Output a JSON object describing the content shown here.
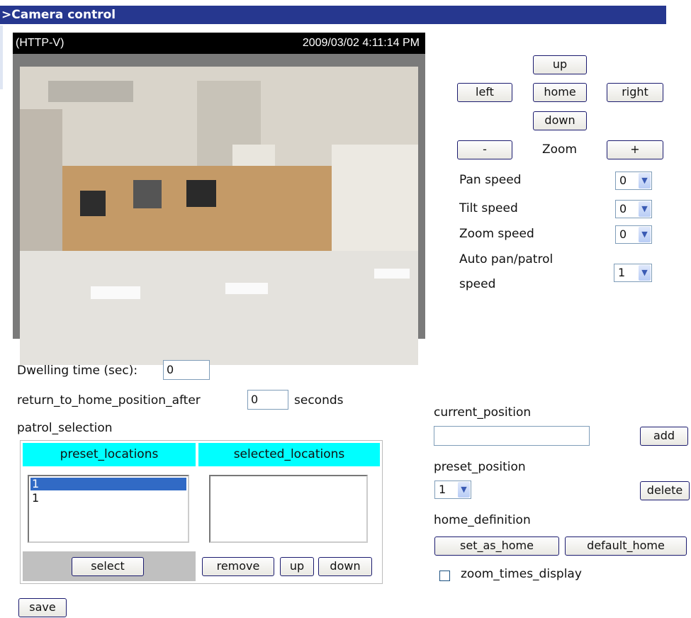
{
  "title": ">Camera control",
  "video": {
    "mode": "(HTTP-V)",
    "timestamp": "2009/03/02 4:11:14 PM"
  },
  "ptz": {
    "up": "up",
    "left": "left",
    "home": "home",
    "right": "right",
    "down": "down",
    "zoom_out": "-",
    "zoom_label": "Zoom",
    "zoom_in": "+"
  },
  "speeds": {
    "pan_label": "Pan speed",
    "pan_value": "0",
    "tilt_label": "Tilt speed",
    "tilt_value": "0",
    "zoom_label": "Zoom speed",
    "zoom_value": "0",
    "auto_label_1": "Auto pan/patrol",
    "auto_label_2": "speed",
    "auto_value": "1"
  },
  "patrol": {
    "dwelling_label": "Dwelling time (sec):",
    "dwelling_value": "0",
    "return_label": "return_to_home_position_after",
    "return_value": "0",
    "return_unit": "seconds",
    "selection_label": "patrol_selection",
    "preset_header": "preset_locations",
    "selected_header": "selected_locations",
    "preset_items": [
      "1",
      "1"
    ],
    "select_button": "select",
    "remove_button": "remove",
    "up_button": "up",
    "down_button": "down"
  },
  "position": {
    "current_label": "current_position",
    "current_value": "",
    "add_button": "add",
    "preset_label": "preset_position",
    "preset_value": "1",
    "delete_button": "delete",
    "home_label": "home_definition",
    "set_home_button": "set_as_home",
    "default_home_button": "default_home",
    "zoom_display_label": "zoom_times_display"
  },
  "save_button": "save",
  "colors": {
    "title_bar": "#26378f",
    "list_header": "#00ffff",
    "selected_item": "#316ac5"
  }
}
